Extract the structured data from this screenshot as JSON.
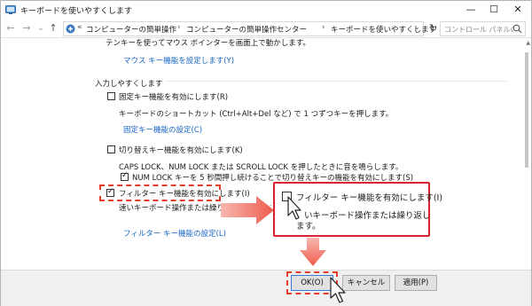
{
  "window": {
    "title": "キーボードを使いやすくします",
    "controls": {
      "minimize": "—",
      "maximize": "☐",
      "close": "✕"
    }
  },
  "nav": {
    "back": "←",
    "forward": "→",
    "dropdown": "⌄",
    "up": "↑",
    "breadcrumb": [
      "コンピューターの簡単操作",
      "コンピューターの簡単操作センター",
      "キーボードを使いやすくします"
    ],
    "breadcrumb_prefix": "«",
    "separator": "›",
    "refresh": "↻",
    "search_placeholder": "コントロール パネルの検索"
  },
  "content": {
    "top_partial_text": "テンキーを使ってマウス ポインターを画面上で動かします。",
    "mouse_keys_link": "マウス キー機能を設定します(Y)",
    "section_header": "入力しやすくします",
    "sticky_keys_label": "固定キー機能を有効にします(R)",
    "sticky_keys_checked": false,
    "sticky_keys_desc": "キーボードのショートカット (Ctrl+Alt+Del など) で 1 つずつキーを押します。",
    "sticky_keys_link": "固定キー機能の設定(C)",
    "toggle_keys_label": "切り替えキー機能を有効にします(K)",
    "toggle_keys_checked": false,
    "toggle_keys_desc": "CAPS LOCK、NUM LOCK または SCROLL LOCK を押したときに音を鳴らします。",
    "toggle_numlock_label": "NUM LOCK キーを 5 秒間押し続けることで切り替えキーの機能を有効にします(S)",
    "toggle_numlock_checked": true,
    "filter_keys_label": "フィルター キー機能を有効にします(I)",
    "filter_keys_checked": true,
    "filter_keys_desc": "速いキーボード操作または繰り返し入力されたキーボード操作",
    "filter_keys_link": "フィルター キー機能の設定(L)"
  },
  "callout": {
    "checkbox_label": "フィルター キー機能を有効にします(I)",
    "checkbox_checked": false,
    "desc_line1": "いキーボード操作または繰り返し入力さ",
    "desc_line2": "ます。"
  },
  "buttons": {
    "ok": "OK(O)",
    "cancel": "キャンセル",
    "apply": "適用(P)"
  },
  "colors": {
    "accent_red": "#e23d2d",
    "link_blue": "#1a66c7",
    "arrow": "#ef5d4f"
  }
}
